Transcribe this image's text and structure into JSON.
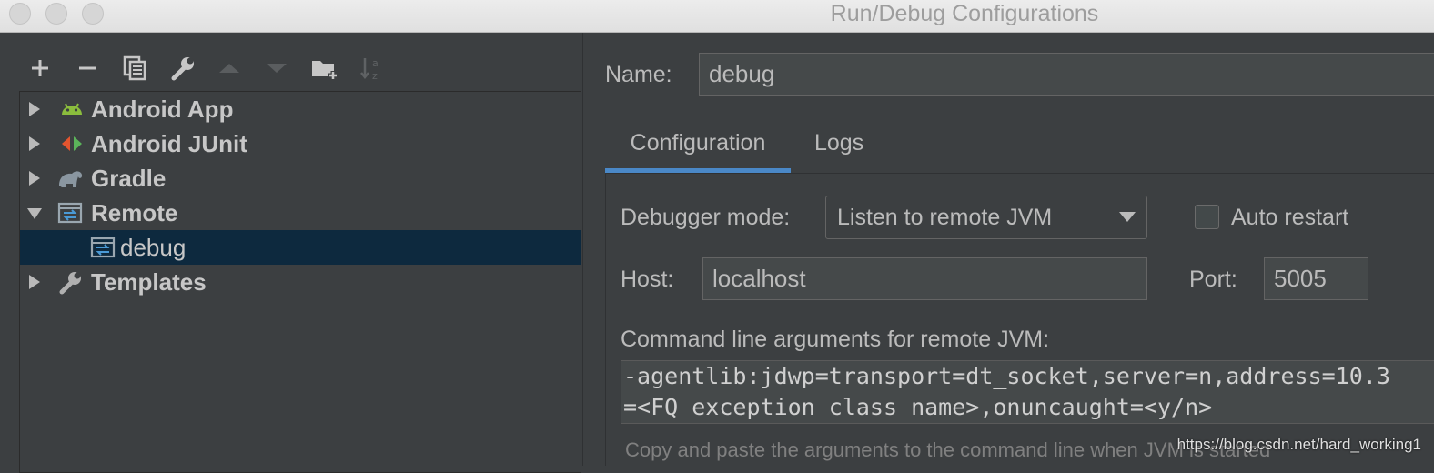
{
  "window": {
    "title": "Run/Debug Configurations"
  },
  "toolbar": {
    "buttons": [
      {
        "name": "add-button",
        "icon": "plus-icon"
      },
      {
        "name": "remove-button",
        "icon": "minus-icon"
      },
      {
        "name": "copy-button",
        "icon": "copy-icon"
      },
      {
        "name": "edit-defaults-button",
        "icon": "wrench-icon"
      },
      {
        "name": "move-up-button",
        "icon": "up-triangle-icon"
      },
      {
        "name": "move-down-button",
        "icon": "down-triangle-icon"
      },
      {
        "name": "new-folder-button",
        "icon": "folder-plus-icon"
      },
      {
        "name": "sort-button",
        "icon": "sort-az-icon"
      }
    ]
  },
  "tree": {
    "items": [
      {
        "label": "Android App",
        "icon": "android-icon",
        "expanded": false
      },
      {
        "label": "Android JUnit",
        "icon": "android-junit-icon",
        "expanded": false
      },
      {
        "label": "Gradle",
        "icon": "gradle-elephant-icon",
        "expanded": false
      },
      {
        "label": "Remote",
        "icon": "remote-icon",
        "expanded": true
      },
      {
        "label": "debug",
        "icon": "remote-icon",
        "selected": true
      },
      {
        "label": "Templates",
        "icon": "wrench-icon",
        "expanded": false
      }
    ]
  },
  "form": {
    "name_label": "Name:",
    "name_value": "debug",
    "tabs": [
      "Configuration",
      "Logs"
    ],
    "active_tab": "Configuration",
    "debugger_mode_label": "Debugger mode:",
    "debugger_mode_value": "Listen to remote JVM",
    "auto_restart_label": "Auto restart",
    "auto_restart_checked": false,
    "host_label": "Host:",
    "host_value": "localhost",
    "port_label": "Port:",
    "port_value": "5005",
    "args_label": "Command line arguments for remote JVM:",
    "args_line1": "-agentlib:jdwp=transport=dt_socket,server=n,address=10.3",
    "args_line2": "=<FQ exception class name>,onuncaught=<y/n>",
    "hint": "Copy and paste the arguments to the command line when JVM is started"
  },
  "watermark": "https://blog.csdn.net/hard_working1",
  "colors": {
    "selection": "#0d293e",
    "tab_underline": "#4a88c7",
    "background": "#3c3f41"
  }
}
